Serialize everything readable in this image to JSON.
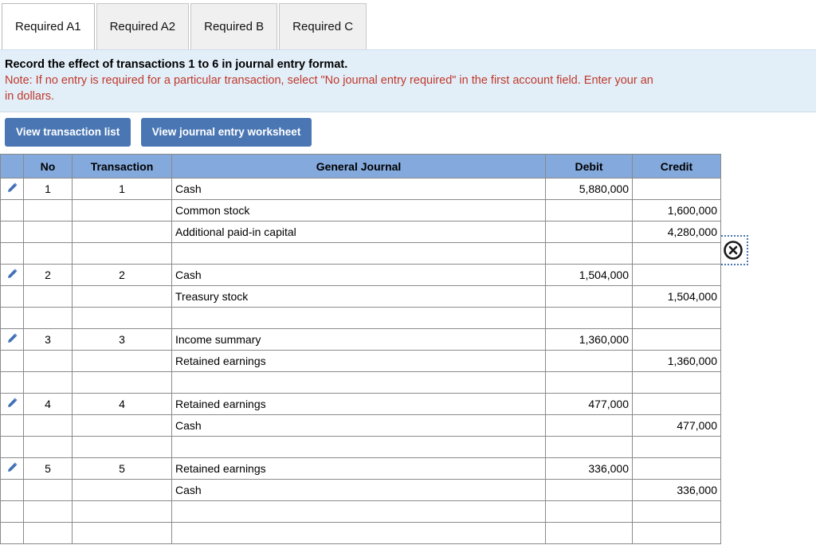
{
  "tabs": [
    {
      "label": "Required A1",
      "active": true
    },
    {
      "label": "Required A2",
      "active": false
    },
    {
      "label": "Required B",
      "active": false
    },
    {
      "label": "Required C",
      "active": false
    }
  ],
  "instructions": {
    "main": "Record the effect of transactions 1 to 6 in journal entry format.",
    "note_line1": "Note: If no entry is required for a particular transaction, select \"No journal entry required\" in the first account field. Enter your an",
    "note_line2": "in dollars."
  },
  "toolbar": {
    "view_transaction_list": "View transaction list",
    "view_journal_entry_worksheet": "View journal entry worksheet",
    "close_icon": "circle-x-icon",
    "edit_icon": "pencil-icon"
  },
  "colors": {
    "accent_button": "#4a77b4",
    "table_header": "#84a9dc",
    "instruction_panel": "#e2eef8",
    "note_text": "#c0392b",
    "grid_border": "#8a8a8a"
  },
  "table": {
    "headers": {
      "no": "No",
      "transaction": "Transaction",
      "general_journal": "General Journal",
      "debit": "Debit",
      "credit": "Credit"
    },
    "rows": [
      {
        "edit": true,
        "no": "1",
        "transaction": "1",
        "account": "Cash",
        "indent": false,
        "debit": "5,880,000",
        "credit": ""
      },
      {
        "edit": false,
        "no": "",
        "transaction": "",
        "account": "Common stock",
        "indent": true,
        "debit": "",
        "credit": "1,600,000"
      },
      {
        "edit": false,
        "no": "",
        "transaction": "",
        "account": "Additional paid-in capital",
        "indent": true,
        "debit": "",
        "credit": "4,280,000"
      },
      {
        "edit": false,
        "no": "",
        "transaction": "",
        "account": "",
        "indent": false,
        "debit": "",
        "credit": ""
      },
      {
        "edit": true,
        "no": "2",
        "transaction": "2",
        "account": "Cash",
        "indent": false,
        "debit": "1,504,000",
        "credit": ""
      },
      {
        "edit": false,
        "no": "",
        "transaction": "",
        "account": "Treasury stock",
        "indent": true,
        "debit": "",
        "credit": "1,504,000"
      },
      {
        "edit": false,
        "no": "",
        "transaction": "",
        "account": "",
        "indent": false,
        "debit": "",
        "credit": ""
      },
      {
        "edit": true,
        "no": "3",
        "transaction": "3",
        "account": "Income summary",
        "indent": false,
        "debit": "1,360,000",
        "credit": ""
      },
      {
        "edit": false,
        "no": "",
        "transaction": "",
        "account": "Retained earnings",
        "indent": true,
        "debit": "",
        "credit": "1,360,000"
      },
      {
        "edit": false,
        "no": "",
        "transaction": "",
        "account": "",
        "indent": false,
        "debit": "",
        "credit": ""
      },
      {
        "edit": true,
        "no": "4",
        "transaction": "4",
        "account": "Retained earnings",
        "indent": false,
        "debit": "477,000",
        "credit": ""
      },
      {
        "edit": false,
        "no": "",
        "transaction": "",
        "account": "Cash",
        "indent": true,
        "debit": "",
        "credit": "477,000"
      },
      {
        "edit": false,
        "no": "",
        "transaction": "",
        "account": "",
        "indent": false,
        "debit": "",
        "credit": ""
      },
      {
        "edit": true,
        "no": "5",
        "transaction": "5",
        "account": "Retained earnings",
        "indent": false,
        "debit": "336,000",
        "credit": ""
      },
      {
        "edit": false,
        "no": "",
        "transaction": "",
        "account": "Cash",
        "indent": true,
        "debit": "",
        "credit": "336,000"
      },
      {
        "edit": false,
        "no": "",
        "transaction": "",
        "account": "",
        "indent": false,
        "debit": "",
        "credit": ""
      },
      {
        "edit": false,
        "no": "",
        "transaction": "",
        "account": "",
        "indent": false,
        "debit": "",
        "credit": ""
      }
    ]
  }
}
